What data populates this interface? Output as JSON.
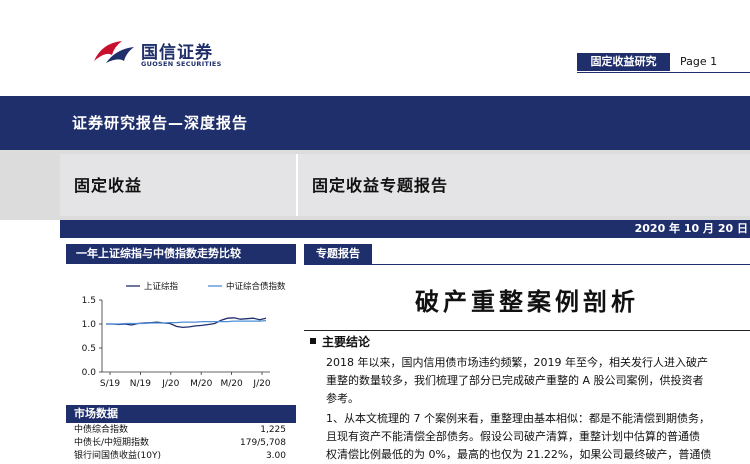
{
  "logo": {
    "name_cn": "国信证券",
    "name_en": "GUOSEN SECURITIES"
  },
  "header": {
    "tag": "固定收益研究",
    "page": "Page 1"
  },
  "banner": {
    "title": "证券研究报告—深度报告"
  },
  "band": {
    "category": "固定收益",
    "report_type": "固定收益专题报告"
  },
  "date": "2020 年 10 月 20 日",
  "sidebar": {
    "chart_heading": "一年上证综指与中债指数走势比较",
    "market_heading": "市场数据",
    "market_rows": [
      {
        "label": "中债综合指数",
        "value": "1,225"
      },
      {
        "label": "中债长/中短期指数",
        "value": "179/5,708"
      },
      {
        "label": "银行间国债收益(10Y)",
        "value": "3.00"
      }
    ]
  },
  "chart_data": {
    "type": "line",
    "x_ticks": [
      "S/19",
      "N/19",
      "J/20",
      "M/20",
      "M/20",
      "J/20"
    ],
    "y_ticks": [
      "0.0",
      "0.5",
      "1.0",
      "1.5"
    ],
    "ylim": [
      0,
      1.5
    ],
    "series": [
      {
        "name": "上证综指",
        "color": "#1f2f6b",
        "values": [
          1.0,
          1.0,
          0.99,
          1.0,
          0.98,
          1.01,
          1.02,
          1.03,
          1.04,
          1.02,
          1.01,
          0.95,
          0.93,
          0.94,
          0.96,
          0.97,
          0.99,
          1.01,
          1.08,
          1.12,
          1.13,
          1.1,
          1.11,
          1.12,
          1.09,
          1.12
        ]
      },
      {
        "name": "中证综合债指数",
        "color": "#4f8ed8",
        "values": [
          1.0,
          1.0,
          1.0,
          1.01,
          1.01,
          1.01,
          1.01,
          1.02,
          1.02,
          1.02,
          1.03,
          1.03,
          1.04,
          1.04,
          1.04,
          1.05,
          1.05,
          1.05,
          1.05,
          1.05,
          1.06,
          1.06,
          1.06,
          1.06,
          1.06,
          1.07
        ]
      }
    ]
  },
  "section_tag": "专题报告",
  "main_title": "破产重整案例剖析",
  "conclusion": {
    "heading": "主要结论",
    "lines": [
      "2018 年以来，国内信用债市场违约频繁，2019 年至今，相关发行人进入破产",
      "重整的数量较多，我们梳理了部分已完成破产重整的 A 股公司案例，供投资者",
      "参考。",
      "1、从本文梳理的 7 个案例来看，重整理由基本相似：都是不能清偿到期债务，",
      "且现有资产不能清偿全部债务。假设公司破产清算，重整计划中估算的普通债",
      "权清偿比例最低的为 0%，最高的也仅为 21.22%，如果公司最终破产，普通债"
    ]
  }
}
